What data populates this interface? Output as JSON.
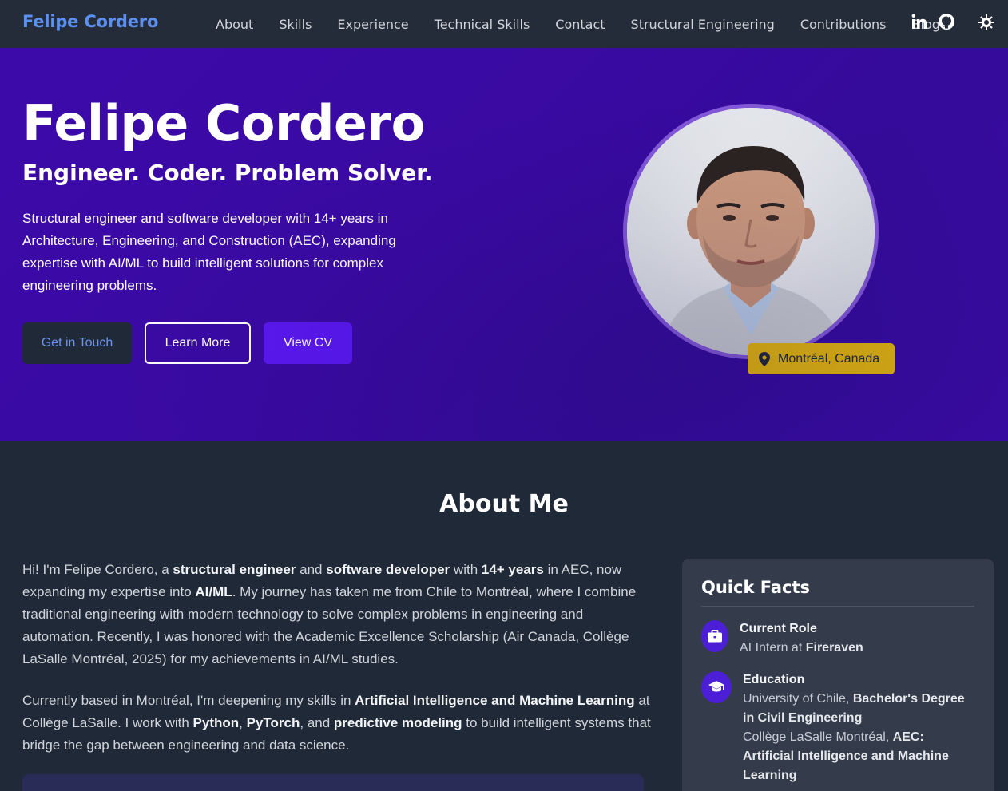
{
  "nav": {
    "brand": "Felipe Cordero",
    "links": [
      "About",
      "Skills",
      "Experience",
      "Technical Skills",
      "Contact",
      "Structural Engineering",
      "Contributions",
      "Blog"
    ],
    "icons": [
      "linkedin-icon",
      "github-icon",
      "theme-toggle-icon"
    ]
  },
  "hero": {
    "name": "Felipe Cordero",
    "tagline": "Engineer. Coder. Problem Solver.",
    "description": "Structural engineer and software developer with 14+ years in Architecture, Engineering, and Construction (AEC), expanding expertise with AI/ML to build intelligent solutions for complex engineering problems.",
    "buttons": {
      "touch": "Get in Touch",
      "learn": "Learn More",
      "cv": "View CV"
    },
    "location": "Montréal, Canada"
  },
  "about": {
    "title": "About Me",
    "p1": [
      {
        "t": "Hi! I'm Felipe Cordero, a "
      },
      {
        "t": "structural engineer",
        "b": true
      },
      {
        "t": " and "
      },
      {
        "t": "software developer",
        "b": true
      },
      {
        "t": " with "
      },
      {
        "t": "14+ years",
        "b": true
      },
      {
        "t": " in AEC, now expanding my expertise into "
      },
      {
        "t": "AI/ML",
        "b": true
      },
      {
        "t": ". My journey has taken me from Chile to Montréal, where I combine traditional engineering with modern technology to solve complex problems in engineering and automation. Recently, I was honored with the Academic Excellence Scholarship (Air Canada, Collège LaSalle Montréal, 2025) for my achievements in AI/ML studies."
      }
    ],
    "p2": [
      {
        "t": "Currently based in Montréal, I'm deepening my skills in "
      },
      {
        "t": "Artificial Intelligence and Machine Learning",
        "b": true
      },
      {
        "t": " at Collège LaSalle. I work with "
      },
      {
        "t": "Python",
        "b": true
      },
      {
        "t": ", "
      },
      {
        "t": "PyTorch",
        "b": true
      },
      {
        "t": ", and "
      },
      {
        "t": "predictive modeling",
        "b": true
      },
      {
        "t": " to build intelligent systems that bridge the gap between engineering and data science."
      }
    ]
  },
  "facts": {
    "title": "Quick Facts",
    "role": {
      "label": "Current Role",
      "value": [
        {
          "t": "AI Intern at "
        },
        {
          "t": "Fireraven",
          "b": true
        }
      ]
    },
    "education": {
      "label": "Education",
      "line1": [
        {
          "t": "University of Chile, "
        },
        {
          "t": "Bachelor's Degree in Civil Engineering",
          "b": true
        }
      ],
      "line2": [
        {
          "t": "Collège LaSalle Montréal, "
        },
        {
          "t": "AEC: Artificial Intelligence and Machine Learning",
          "b": true
        }
      ]
    }
  },
  "colors": {
    "brand": "#5b8ff0",
    "hero_bg": "#3c0aa9",
    "accent_button": "#5a18f0",
    "location_badge": "#e5b70c",
    "page_bg": "#1f2937",
    "card_bg": "#343c4c"
  }
}
